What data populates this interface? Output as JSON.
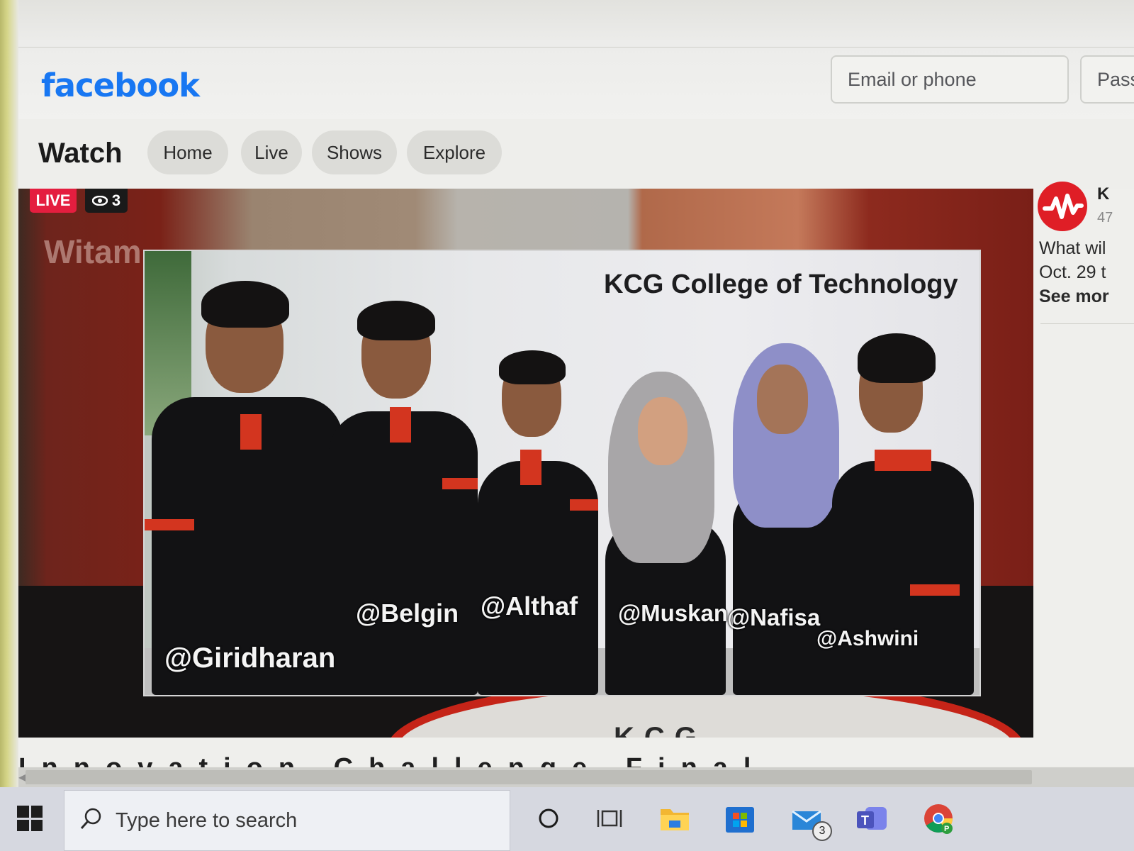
{
  "header": {
    "logo": "facebook",
    "email_placeholder": "Email or phone",
    "password_placeholder": "Pass"
  },
  "watch_nav": {
    "title": "Watch",
    "tabs": [
      "Home",
      "Live",
      "Shows",
      "Explore"
    ]
  },
  "video": {
    "live_badge": "LIVE",
    "viewer_count": "3",
    "background_banner": "Witam",
    "stage_letters": "KCG",
    "photo_title": "KCG College of Technology",
    "people": [
      {
        "name": "@Giridharan"
      },
      {
        "name": "@Belgin"
      },
      {
        "name": "@Althaf"
      },
      {
        "name": "@Muskan"
      },
      {
        "name": "@Nafisa"
      },
      {
        "name": "@Ashwini"
      }
    ]
  },
  "sidebar": {
    "page_name": "K",
    "meta": "47",
    "description_line1": "What wil",
    "description_line2": "Oct. 29 t",
    "see_more": "See mor"
  },
  "below_video": {
    "title_partial": "Innovation Challenge Final"
  },
  "taskbar": {
    "search_placeholder": "Type here to search",
    "mail_badge": "3",
    "icons": [
      "windows-start-icon",
      "search-icon",
      "cortana-icon",
      "task-view-icon",
      "file-explorer-icon",
      "store-icon",
      "mail-icon",
      "teams-icon",
      "chrome-icon"
    ]
  },
  "colors": {
    "facebook_blue": "#1877f2",
    "live_red": "#e41e3f",
    "shirt_red": "#d3351f"
  }
}
